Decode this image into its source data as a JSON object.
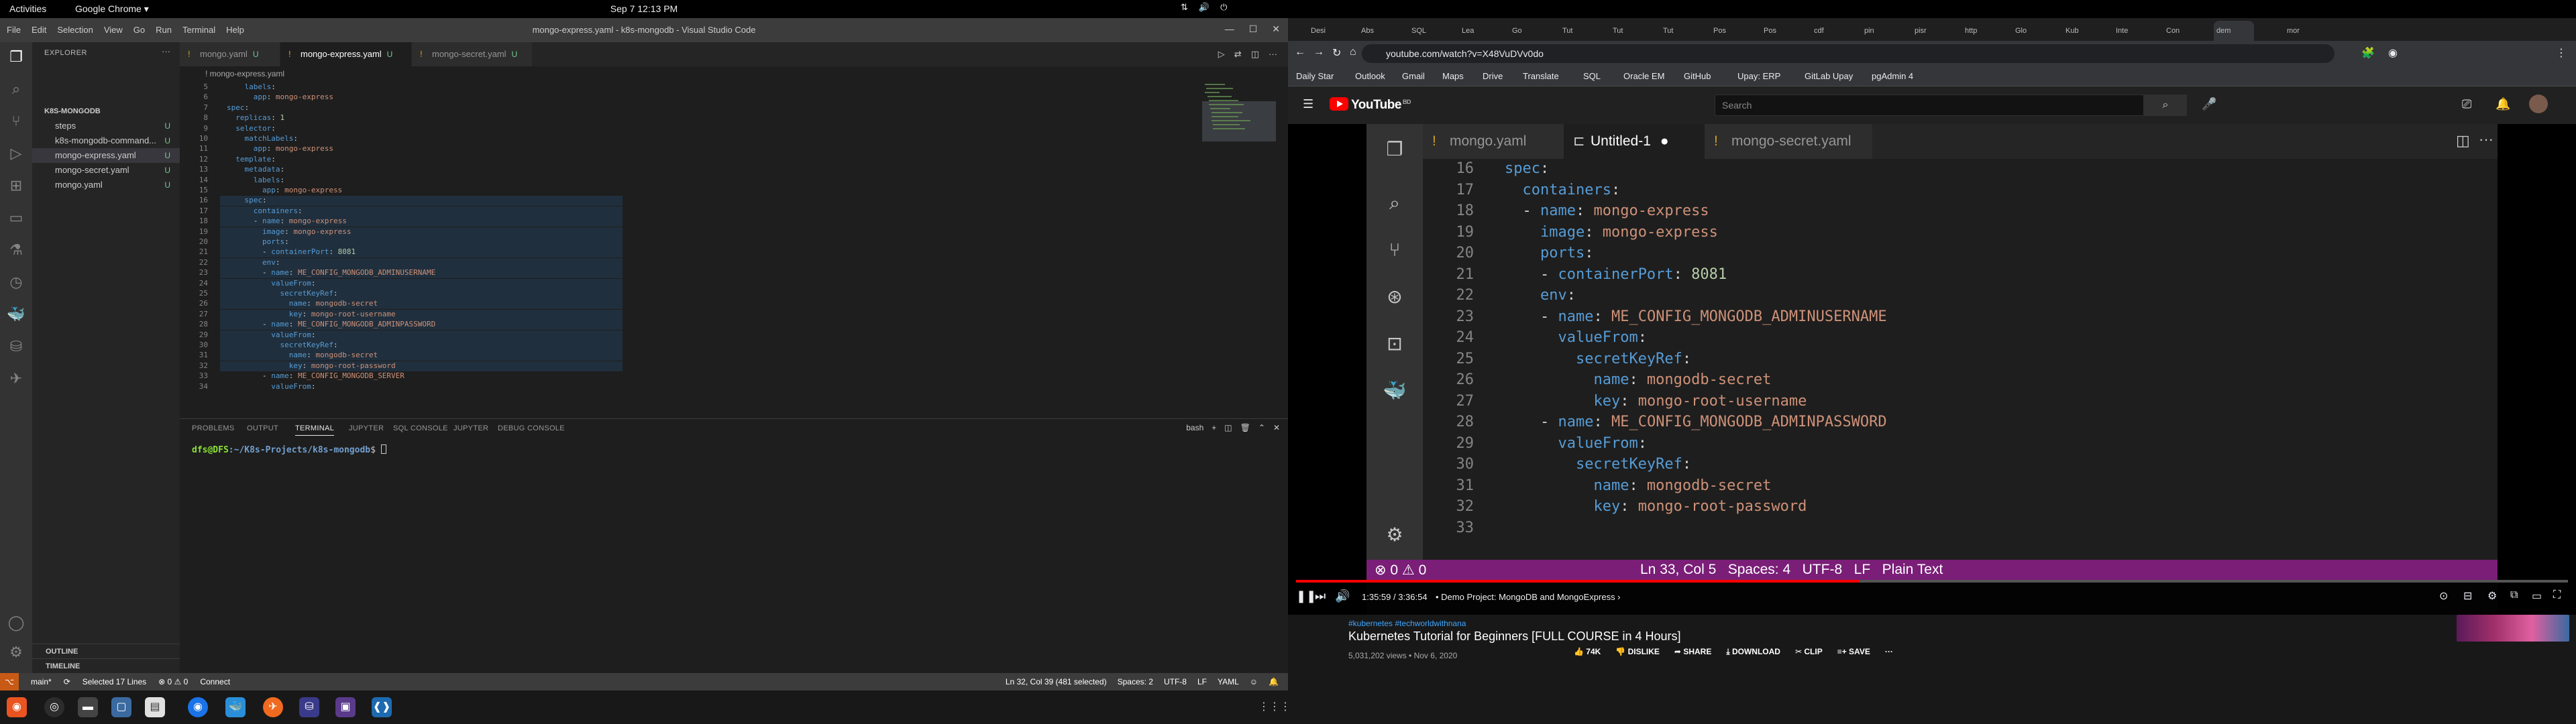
{
  "topbar": {
    "activities": "Activities",
    "app": "Google Chrome ▾",
    "clock": "Sep 7  12:13 PM"
  },
  "vscode": {
    "window_title": "mongo-express.yaml - k8s-mongodb - Visual Studio Code",
    "menu": [
      "File",
      "Edit",
      "Selection",
      "View",
      "Go",
      "Run",
      "Terminal",
      "Help"
    ],
    "explorer": {
      "header": "EXPLORER",
      "root": "K8S-MONGODB",
      "items": [
        {
          "label": "steps",
          "badge": "U"
        },
        {
          "label": "k8s-mongodb-command...",
          "badge": "U"
        },
        {
          "label": "mongo-express.yaml",
          "badge": "U"
        },
        {
          "label": "mongo-secret.yaml",
          "badge": "U"
        },
        {
          "label": "mongo.yaml",
          "badge": "U"
        }
      ],
      "outline": "OUTLINE",
      "timeline": "TIMELINE"
    },
    "tabs": [
      {
        "label": "mongo.yaml",
        "badge": "U"
      },
      {
        "label": "mongo-express.yaml",
        "badge": "U"
      },
      {
        "label": "mongo-secret.yaml",
        "badge": "U"
      }
    ],
    "breadcrumb": "! mongo-express.yaml",
    "code": [
      {
        "n": "5",
        "t": "    labels:"
      },
      {
        "n": "6",
        "t": "      app: mongo-express"
      },
      {
        "n": "7",
        "t": "spec:"
      },
      {
        "n": "8",
        "t": "  replicas: 1"
      },
      {
        "n": "9",
        "t": "  selector:"
      },
      {
        "n": "10",
        "t": "    matchLabels:"
      },
      {
        "n": "11",
        "t": "      app: mongo-express"
      },
      {
        "n": "12",
        "t": "  template:"
      },
      {
        "n": "13",
        "t": "    metadata:"
      },
      {
        "n": "14",
        "t": "      labels:"
      },
      {
        "n": "15",
        "t": "        app: mongo-express"
      },
      {
        "n": "16",
        "t": "    spec:"
      },
      {
        "n": "17",
        "t": "      containers:"
      },
      {
        "n": "18",
        "t": "      - name: mongo-express"
      },
      {
        "n": "19",
        "t": "        image: mongo-express"
      },
      {
        "n": "20",
        "t": "        ports:"
      },
      {
        "n": "21",
        "t": "        - containerPort: 8081"
      },
      {
        "n": "22",
        "t": "        env:"
      },
      {
        "n": "23",
        "t": "        - name: ME_CONFIG_MONGODB_ADMINUSERNAME"
      },
      {
        "n": "24",
        "t": "          valueFrom:"
      },
      {
        "n": "25",
        "t": "            secretKeyRef:"
      },
      {
        "n": "26",
        "t": "              name: mongodb-secret"
      },
      {
        "n": "27",
        "t": "              key: mongo-root-username"
      },
      {
        "n": "28",
        "t": "        - name: ME_CONFIG_MONGODB_ADMINPASSWORD"
      },
      {
        "n": "29",
        "t": "          valueFrom:"
      },
      {
        "n": "30",
        "t": "            secretKeyRef:"
      },
      {
        "n": "31",
        "t": "              name: mongodb-secret"
      },
      {
        "n": "32",
        "t": "              key: mongo-root-password"
      },
      {
        "n": "33",
        "t": "        - name: ME_CONFIG_MONGODB_SERVER"
      },
      {
        "n": "34",
        "t": "          valueFrom:"
      }
    ],
    "panel": {
      "tabs": [
        "PROBLEMS",
        "OUTPUT",
        "TERMINAL",
        "JUPYTER",
        "SQL CONSOLE",
        "JUPYTER",
        "DEBUG CONSOLE"
      ],
      "shell": "bash",
      "prompt_user": "dfs@DFS",
      "prompt_path": ":~/K8s-Projects/k8s-mongodb",
      "prompt_end": "$ "
    },
    "status": {
      "branch": "main*",
      "sync": "⟳",
      "selection": "Selected 17 Lines",
      "problems": "⊗ 0 ⚠ 0",
      "connect": "Connect",
      "cursor": "Ln 32, Col 39 (481 selected)",
      "spaces": "Spaces: 2",
      "encoding": "UTF-8",
      "eol": "LF",
      "lang": "YAML"
    }
  },
  "chrome": {
    "url": "youtube.com/watch?v=X48VuDVv0do",
    "bookmarks": [
      "Daily Star",
      "Outlook",
      "Gmail",
      "Maps",
      "Drive",
      "Translate",
      "SQL",
      "Oracle EM",
      "GitHub",
      "Upay: ERP",
      "GitLab Upay",
      "pgAdmin 4"
    ],
    "tab_labels": [
      "Desi",
      "Abs",
      "SQL",
      "Lea",
      "Go",
      "Tut",
      "Tut",
      "Tut",
      "Pos",
      "Pos",
      "cdf",
      "pin",
      "pisr",
      "http",
      "Glo",
      "Kub",
      "Inte",
      "Con",
      "dem",
      "mor"
    ],
    "youtube": {
      "logo": "YouTube",
      "region": "BD",
      "search_placeholder": "Search",
      "video": {
        "tabs": [
          "mongo.yaml",
          "Untitled-1",
          "mongo-secret.yaml"
        ],
        "code": [
          {
            "n": "16",
            "t": "spec:"
          },
          {
            "n": "17",
            "t": "  containers:"
          },
          {
            "n": "18",
            "t": "  - name: mongo-express"
          },
          {
            "n": "19",
            "t": "    image: mongo-express"
          },
          {
            "n": "20",
            "t": "    ports:"
          },
          {
            "n": "21",
            "t": "    - containerPort: 8081"
          },
          {
            "n": "22",
            "t": "    env:"
          },
          {
            "n": "23",
            "t": "    - name: ME_CONFIG_MONGODB_ADMINUSERNAME"
          },
          {
            "n": "24",
            "t": "      valueFrom:"
          },
          {
            "n": "25",
            "t": "        secretKeyRef:"
          },
          {
            "n": "26",
            "t": "          name: mongodb-secret"
          },
          {
            "n": "27",
            "t": "          key: mongo-root-username"
          },
          {
            "n": "28",
            "t": "    - name: ME_CONFIG_MONGODB_ADMINPASSWORD"
          },
          {
            "n": "29",
            "t": "      valueFrom:"
          },
          {
            "n": "30",
            "t": "        secretKeyRef:"
          },
          {
            "n": "31",
            "t": "          name: mongodb-secret"
          },
          {
            "n": "32",
            "t": "          key: mongo-root-password"
          },
          {
            "n": "33",
            "t": ""
          }
        ],
        "status_left": "⊗ 0  ⚠ 0",
        "status_right": "Ln 33, Col 5   Spaces: 4   UTF-8   LF   Plain Text"
      },
      "player": {
        "time": "1:35:59 / 3:36:54",
        "chapter": "• Demo Project: MongoDB and MongoExpress ›",
        "progress": 0.443
      },
      "hashtags": "#kubernetes #techworldwithnana",
      "title": "Kubernetes Tutorial for Beginners [FULL COURSE in 4 Hours]",
      "views": "5,031,202 views • Nov 6, 2020",
      "likes": "74K",
      "dislike": "DISLIKE",
      "share": "SHARE",
      "download": "DOWNLOAD",
      "clip": "CLIP",
      "save": "SAVE"
    }
  }
}
